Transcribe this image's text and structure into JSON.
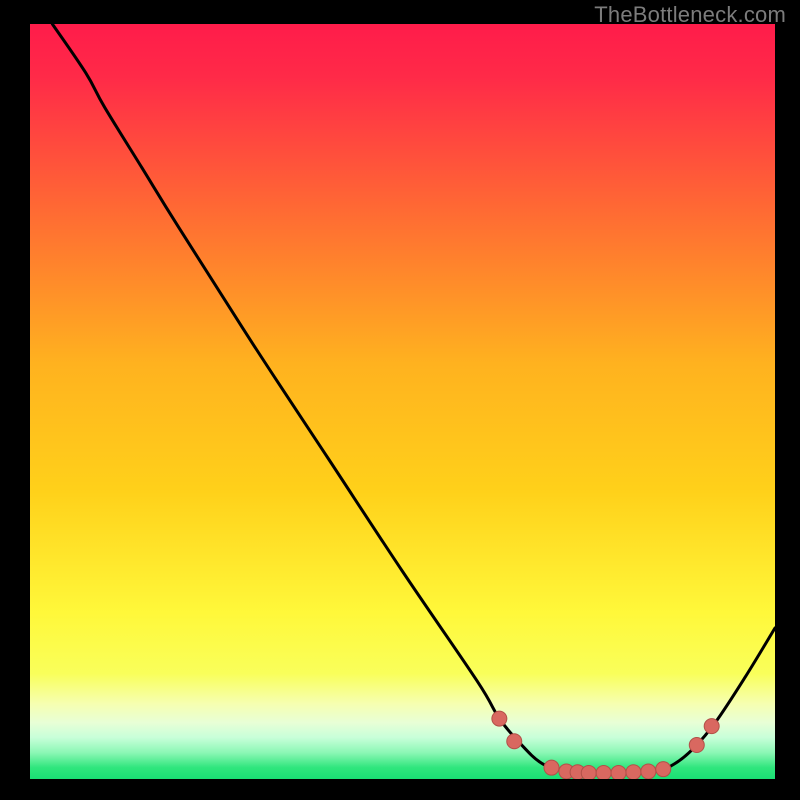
{
  "watermark": "TheBottleneck.com",
  "colors": {
    "background": "#000000",
    "gradient_top": "#ff1c4a",
    "gradient_upper": "#ff6a2e",
    "gradient_mid": "#ffd11a",
    "gradient_lower": "#f9ff5a",
    "gradient_pale": "#f6ffb0",
    "gradient_bottom": "#2fe67d",
    "curve": "#000000",
    "marker_fill": "#d96860",
    "marker_stroke": "#b25048"
  },
  "chart_data": {
    "type": "line",
    "title": "",
    "xlabel": "",
    "ylabel": "",
    "xlim": [
      0,
      100
    ],
    "ylim": [
      0,
      100
    ],
    "curve": {
      "name": "bottleneck-curve",
      "points": [
        {
          "x": 3.0,
          "y": 100.0
        },
        {
          "x": 7.5,
          "y": 93.5
        },
        {
          "x": 10.0,
          "y": 89.0
        },
        {
          "x": 15.0,
          "y": 81.0
        },
        {
          "x": 20.0,
          "y": 73.0
        },
        {
          "x": 30.0,
          "y": 57.5
        },
        {
          "x": 40.0,
          "y": 42.5
        },
        {
          "x": 50.0,
          "y": 27.5
        },
        {
          "x": 60.0,
          "y": 13.0
        },
        {
          "x": 63.0,
          "y": 8.0
        },
        {
          "x": 66.0,
          "y": 4.5
        },
        {
          "x": 68.5,
          "y": 2.2
        },
        {
          "x": 71.0,
          "y": 1.2
        },
        {
          "x": 75.0,
          "y": 0.7
        },
        {
          "x": 80.0,
          "y": 0.7
        },
        {
          "x": 84.0,
          "y": 1.0
        },
        {
          "x": 86.5,
          "y": 2.0
        },
        {
          "x": 89.0,
          "y": 4.0
        },
        {
          "x": 92.0,
          "y": 7.5
        },
        {
          "x": 96.0,
          "y": 13.5
        },
        {
          "x": 100.0,
          "y": 20.0
        }
      ]
    },
    "markers": [
      {
        "x": 63.0,
        "y": 8.0
      },
      {
        "x": 65.0,
        "y": 5.0
      },
      {
        "x": 70.0,
        "y": 1.5
      },
      {
        "x": 72.0,
        "y": 1.0
      },
      {
        "x": 73.5,
        "y": 0.9
      },
      {
        "x": 75.0,
        "y": 0.8
      },
      {
        "x": 77.0,
        "y": 0.8
      },
      {
        "x": 79.0,
        "y": 0.8
      },
      {
        "x": 81.0,
        "y": 0.9
      },
      {
        "x": 83.0,
        "y": 1.0
      },
      {
        "x": 85.0,
        "y": 1.3
      },
      {
        "x": 89.5,
        "y": 4.5
      },
      {
        "x": 91.5,
        "y": 7.0
      }
    ]
  }
}
